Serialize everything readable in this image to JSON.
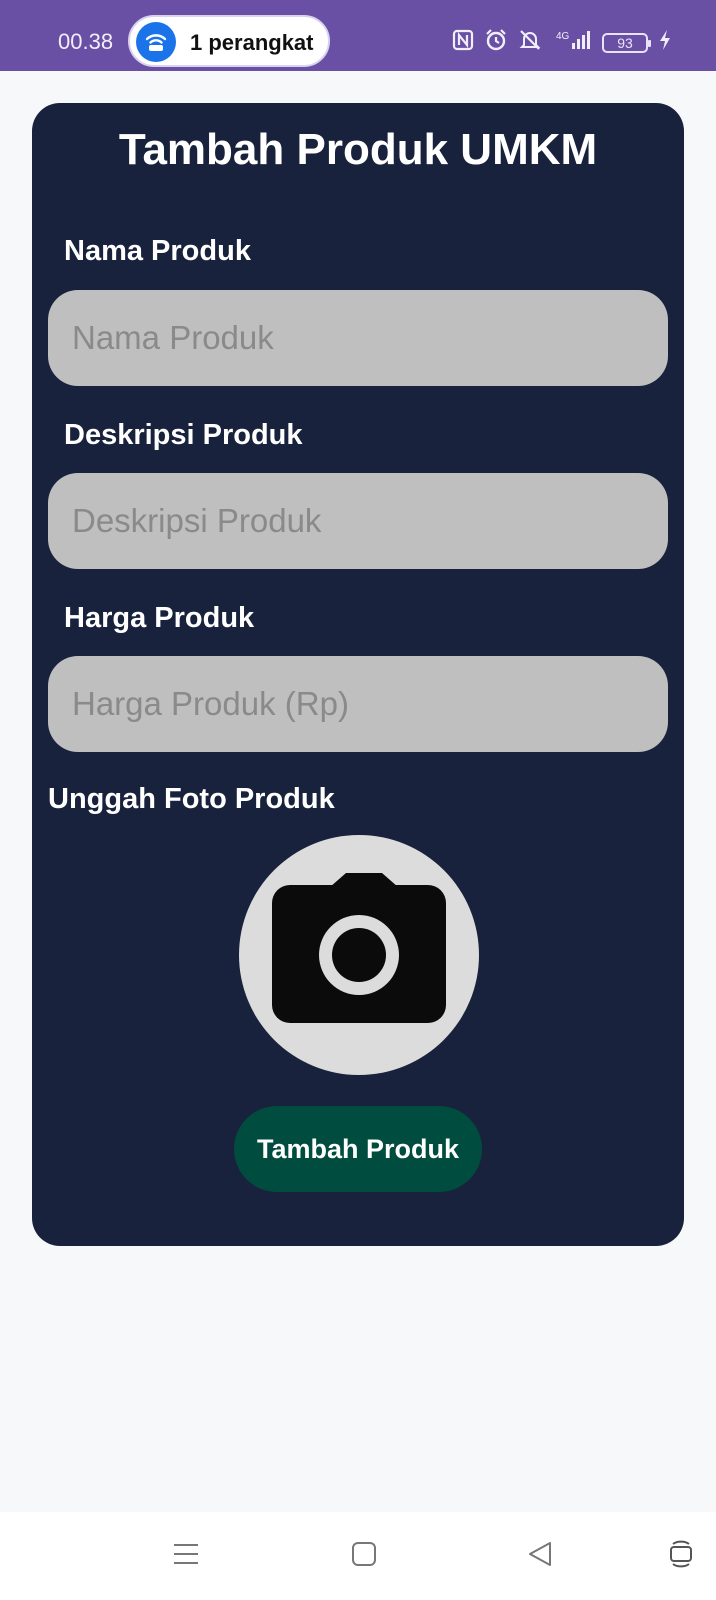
{
  "status_bar": {
    "time": "00.38",
    "hotspot_text": "1 perangkat",
    "battery_level": "93",
    "network_label": "4G",
    "icons": [
      "hotspot-icon",
      "nfc-icon",
      "alarm-icon",
      "mute-icon",
      "signal-icon",
      "battery-icon",
      "charging-icon"
    ]
  },
  "form": {
    "title": "Tambah Produk UMKM",
    "name_label": "Nama Produk",
    "name_placeholder": "Nama Produk",
    "name_value": "",
    "description_label": "Deskripsi Produk",
    "description_placeholder": "Deskripsi Produk",
    "description_value": "",
    "price_label": "Harga Produk",
    "price_placeholder": "Harga Produk (Rp)",
    "price_value": "",
    "upload_label": "Unggah Foto Produk",
    "upload_icon": "camera-icon",
    "submit_label": "Tambah Produk"
  },
  "nav": {
    "icons": [
      "menu-icon",
      "home-icon",
      "back-icon",
      "rotate-icon"
    ]
  },
  "colors": {
    "status_bar": "#6a50a4",
    "background": "#f7f8fa",
    "card": "#19223c",
    "input": "#bfbfbf",
    "button": "#004d3f"
  }
}
